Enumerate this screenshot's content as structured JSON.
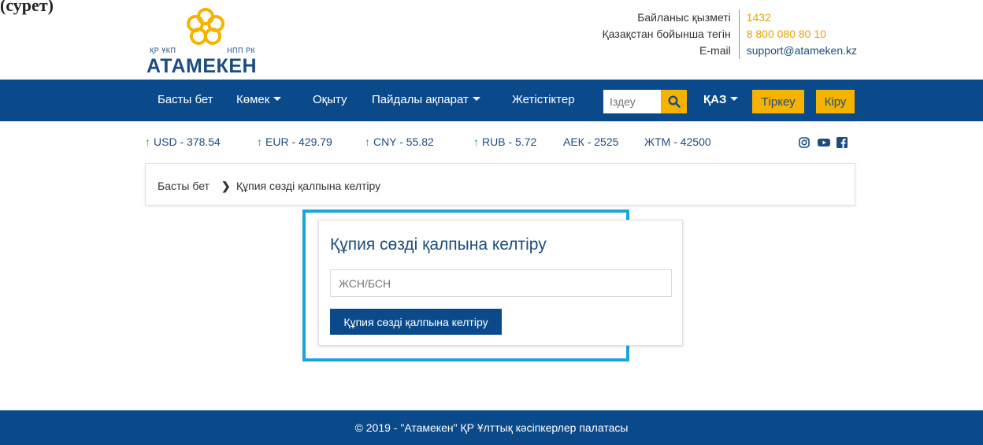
{
  "fragment": "(сурет)",
  "logo": {
    "small_left": "ҚР ҰКП",
    "small_right": "НПП РК",
    "brand": "АТАМЕКЕН"
  },
  "contacts": [
    {
      "label": "Байланыс қызметі",
      "value": "1432"
    },
    {
      "label": "Қазақстан бойынша тегін",
      "value": "8 800 080 80 10"
    },
    {
      "label": "E-mail",
      "value": "support@atameken.kz"
    }
  ],
  "nav": {
    "items": [
      "Басты бет",
      "Көмек",
      "Оқыту",
      "Пайдалы ақпарат",
      "Жетістіктер"
    ],
    "search_placeholder": "Іздеу",
    "lang": "ҚАЗ",
    "register": "Тіркеу",
    "login": "Кіру"
  },
  "rates": [
    "USD - 378.54",
    "EUR - 429.79",
    "CNY - 55.82",
    "RUB - 5.72",
    "АЕК - 2525",
    "ЖТМ - 42500"
  ],
  "breadcrumb": {
    "home": "Басты бет",
    "current": "Құпия сөзді қалпына келтіру"
  },
  "form": {
    "title": "Құпия сөзді қалпына келтіру",
    "input_placeholder": "ЖСН/БСН",
    "submit": "Құпия сөзді қалпына келтіру"
  },
  "footer": "© 2019 - \"Атамекен\" ҚР Ұлттық кәсіпкерлер палатасы",
  "colors": {
    "primary": "#0b4a8a",
    "accent": "#f5b300",
    "highlight": "#1aa6dd",
    "rate_up": "#2a9a3a"
  }
}
